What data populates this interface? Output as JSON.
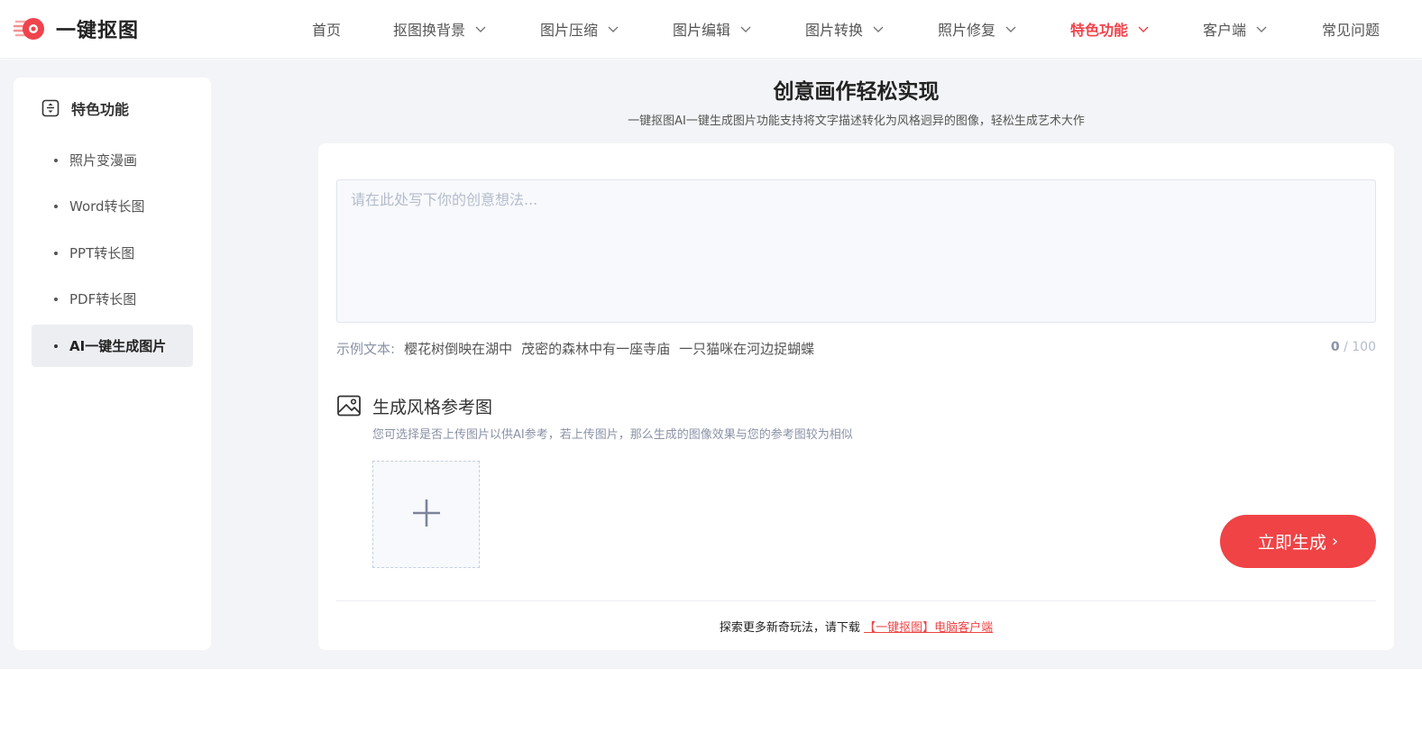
{
  "header": {
    "brand": "一键抠图",
    "nav": [
      {
        "label": "首页",
        "dropdown": false,
        "active": false
      },
      {
        "label": "抠图换背景",
        "dropdown": true,
        "active": false
      },
      {
        "label": "图片压缩",
        "dropdown": true,
        "active": false
      },
      {
        "label": "图片编辑",
        "dropdown": true,
        "active": false
      },
      {
        "label": "图片转换",
        "dropdown": true,
        "active": false
      },
      {
        "label": "照片修复",
        "dropdown": true,
        "active": false
      },
      {
        "label": "特色功能",
        "dropdown": true,
        "active": true
      },
      {
        "label": "客户端",
        "dropdown": true,
        "active": false
      },
      {
        "label": "常见问题",
        "dropdown": false,
        "active": false
      }
    ]
  },
  "sidebar": {
    "heading": "特色功能",
    "heading_icon": "sort-box-icon",
    "items": [
      {
        "label": "照片变漫画",
        "active": false
      },
      {
        "label": "Word转长图",
        "active": false
      },
      {
        "label": "PPT转长图",
        "active": false
      },
      {
        "label": "PDF转长图",
        "active": false
      },
      {
        "label": "AI一键生成图片",
        "active": true
      }
    ]
  },
  "main": {
    "title": "创意画作轻松实现",
    "subtitle": "一键抠图AI一键生成图片功能支持将文字描述转化为风格迥异的图像，轻松生成艺术大作",
    "prompt": {
      "value": "",
      "placeholder": "请在此处写下你的创意想法..."
    },
    "examples_label": "示例文本:",
    "examples": [
      "樱花树倒映在湖中",
      "茂密的森林中有一座寺庙",
      "一只猫咪在河边捉蝴蝶"
    ],
    "counter_current": "0",
    "counter_max": " / 100",
    "reference": {
      "title": "生成风格参考图",
      "description": "您可选择是否上传图片以供AI参考，若上传图片，那么生成的图像效果与您的参考图较为相似",
      "icon": "image-icon",
      "upload_icon": "plus-icon"
    },
    "generate_label": "立即生成",
    "generate_arrow": "›",
    "footer_text": "探索更多新奇玩法，请下载",
    "footer_link": "【一键抠图】电脑客户端"
  },
  "colors": {
    "accent": "#ef4346",
    "page_bg": "#f3f4f7",
    "text": "#333333",
    "muted": "#8a92a6"
  }
}
